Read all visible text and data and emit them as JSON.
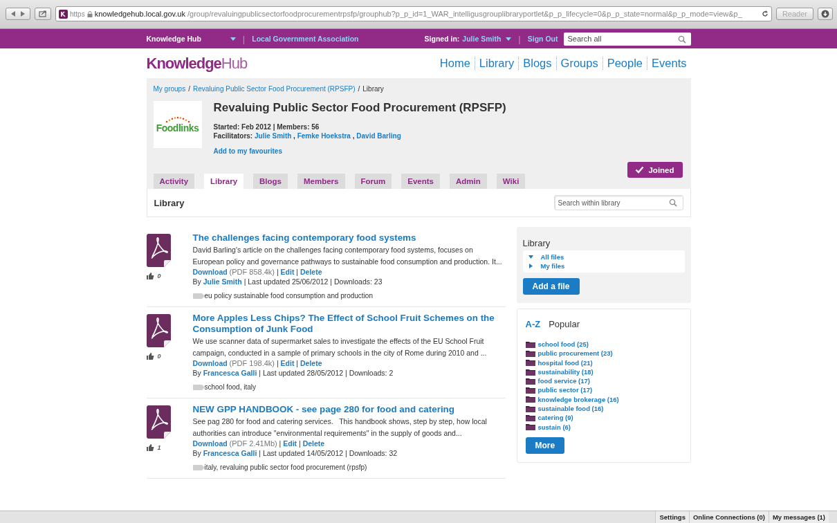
{
  "browser": {
    "scheme": "https",
    "domain": "knowledgehub.local.gov.uk",
    "path": "/group/revaluingpublicsectorfoodprocurementrpsfp/grouphub?p_p_id=1_WAR_intelligusgrouplibraryportlet&p_p_lifecycle=0&p_p_state=normal&p_p_mode=view&p_",
    "reader": "Reader"
  },
  "topbar": {
    "site": "Knowledge Hub",
    "org": "Local Government Association",
    "signed_in": "Signed in:",
    "user": "Julie Smith",
    "sign_out": "Sign Out",
    "search_placeholder": "Search all",
    "sep": "|"
  },
  "header": {
    "logo_main": "Knowledge",
    "logo_light": "Hub",
    "nav": [
      "Home",
      "Library",
      "Blogs",
      "Groups",
      "People",
      "Events"
    ]
  },
  "group": {
    "breadcrumb": [
      {
        "label": "My groups",
        "link": true
      },
      {
        "label": "Revaluing Public Sector Food Procurement (RPSFP)",
        "link": true
      },
      {
        "label": "Library",
        "link": false
      }
    ],
    "crumb_sep": "/",
    "logo_text": "Foodlinks",
    "title": "Revaluing Public Sector Food Procurement (RPSFP)",
    "meta": "Started: Feb 2012 | Members: 56",
    "facilitators_label": "Facilitators:",
    "facilitators": [
      "Julie Smith",
      "Femke Hoekstra",
      "David Barling"
    ],
    "facilitator_sep": ",",
    "favourite": "Add to my favourites",
    "joined": "Joined",
    "tabs": [
      {
        "label": "Activity",
        "selected": false
      },
      {
        "label": "Library",
        "selected": true
      },
      {
        "label": "Blogs",
        "selected": false
      },
      {
        "label": "Members",
        "selected": false
      },
      {
        "label": "Forum",
        "selected": false
      },
      {
        "label": "Events",
        "selected": false
      },
      {
        "label": "Admin",
        "selected": false
      },
      {
        "label": "Wiki",
        "selected": false
      }
    ]
  },
  "library_bar": {
    "title": "Library",
    "search_placeholder": "Search within library"
  },
  "files": [
    {
      "title": "The challenges facing contemporary food systems",
      "description": "David Barling's article on the challenges facing contemporary food systems, focuses on European policy and governance pathways to sustainable food consumption and production. It...",
      "likes": "0",
      "download": "Download",
      "size": "(PDF 858.4k)",
      "actions": [
        "Edit",
        "Delete"
      ],
      "by": "By",
      "author": "Julie Smith",
      "info": "| Last updated 25/06/2012 | Downloads: 23",
      "tags": "eu policy sustainable food consumption and production"
    },
    {
      "title": "More Apples Less Chips? The Effect of School Fruit Schemes on the Consumption of Junk Food",
      "description": "We use scanner data of supermarket sales to investigate the effects of the EU School Fruit campaign, conducted in a sample of primary schools in the city of Rome during 2010 and ...",
      "likes": "0",
      "download": "Download",
      "size": "(PDF 198.4k)",
      "actions": [
        "Edit",
        "Delete"
      ],
      "by": "By",
      "author": "Francesca Galli",
      "info": "| Last updated 28/05/2012 | Downloads: 2",
      "tags": "school food, italy"
    },
    {
      "title": "NEW GPP HANDBOOK - see page 280 for food and catering",
      "description": "See pag 280 for food and catering services.   This handbook shows, step by step, how local authorities can introduce \"environmental requirements\" in the supply of goods and...",
      "likes": "1",
      "download": "Download",
      "size": "(PDF 2.41Mb)",
      "actions": [
        "Edit",
        "Delete"
      ],
      "by": "By",
      "author": "Francesca Galli",
      "info": "| Last updated 14/05/2012 | Downloads: 32",
      "tags": "italy, revaluing public sector food procurement (rpsfp)"
    }
  ],
  "sidebar": {
    "library": {
      "title": "Library",
      "tree": [
        {
          "label": "All files",
          "expanded": true
        },
        {
          "label": "My files",
          "expanded": false
        }
      ],
      "add_button": "Add a file"
    },
    "tags_panel": {
      "tabs": [
        {
          "label": "A-Z",
          "selected": false
        },
        {
          "label": "Popular",
          "selected": true
        }
      ],
      "tags": [
        "school food (25)",
        "public procurement (23)",
        "hospital food (21)",
        "sustainability (18)",
        "food service (17)",
        "public sector (17)",
        "knowledge brokerage (16)",
        "sustainable food (16)",
        "catering (9)",
        "sustain (6)"
      ],
      "more": "More"
    }
  },
  "footer": [
    "Settings",
    "Online Connections (0)",
    "My messages (1)"
  ]
}
